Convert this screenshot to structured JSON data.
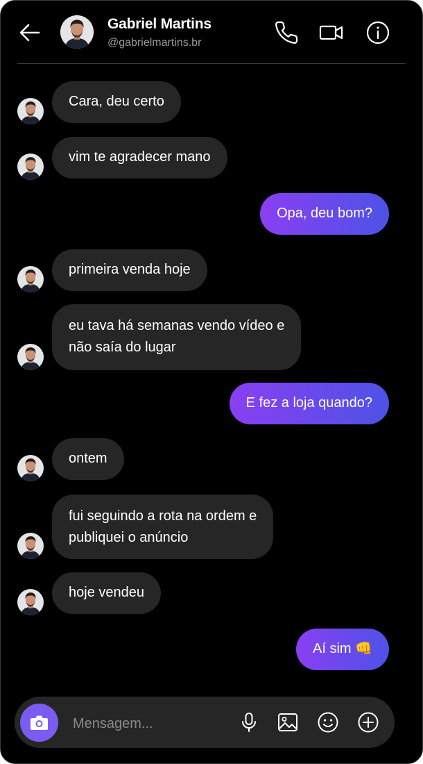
{
  "header": {
    "name": "Gabriel Martins",
    "handle": "@gabrielmartins.br",
    "icons": {
      "back": "arrow-left-icon",
      "call": "phone-icon",
      "video": "video-camera-icon",
      "info": "info-icon"
    }
  },
  "messages": [
    {
      "side": "in",
      "lines": [
        "Cara, deu certo"
      ]
    },
    {
      "side": "in",
      "lines": [
        "vim te agradecer mano"
      ]
    },
    {
      "side": "out",
      "lines": [
        "Opa, deu bom?"
      ]
    },
    {
      "side": "in",
      "lines": [
        "primeira venda hoje"
      ]
    },
    {
      "side": "in",
      "lines": [
        "eu tava há semanas vendo vídeo e",
        "não saía do lugar"
      ]
    },
    {
      "side": "out",
      "lines": [
        "E fez a loja quando?"
      ]
    },
    {
      "side": "in",
      "lines": [
        "ontem"
      ]
    },
    {
      "side": "in",
      "lines": [
        "fui seguindo a rota na ordem e",
        "publiquei o anúncio"
      ]
    },
    {
      "side": "in",
      "lines": [
        "hoje vendeu"
      ]
    },
    {
      "side": "out",
      "lines": [
        "Aí sim 👊"
      ]
    }
  ],
  "composer": {
    "placeholder": "Mensagem...",
    "icons": {
      "camera": "camera-icon",
      "mic": "microphone-icon",
      "gallery": "image-icon",
      "emoji": "emoji-icon",
      "add": "plus-circle-icon"
    }
  },
  "colors": {
    "background": "#000000",
    "incoming_bubble": "#262626",
    "outgoing_gradient_start": "#8a3ff2",
    "outgoing_gradient_end": "#4d52e6",
    "camera_button": "#7a5cf0"
  }
}
